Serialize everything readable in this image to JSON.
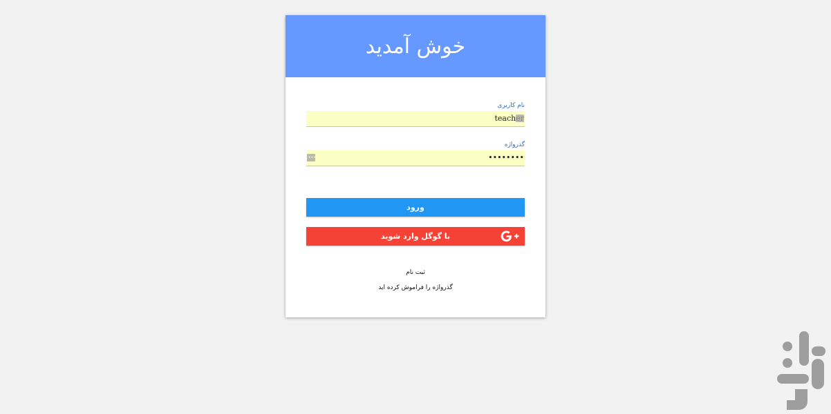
{
  "header": {
    "title": "خوش آمدید"
  },
  "form": {
    "username_label": "نام کاربری",
    "username_value": "teacher",
    "password_label": "گذرواژه",
    "password_value": "teacher1"
  },
  "buttons": {
    "login_label": "ورود",
    "google_label": "با گوگل وارد شوید"
  },
  "links": {
    "register": "ثبت نام",
    "forgot_password": "گذرواژه را فراموش کرده اید"
  },
  "colors": {
    "header": "#6699ff",
    "login_button": "#2196f3",
    "google_button": "#f44336",
    "label": "#2c6db3",
    "autofill_bg": "#fcffc4",
    "brand_logo": "#9e9e9e"
  },
  "icons": {
    "google": "google-plus-icon",
    "autofill_username": "autofill-key-icon",
    "autofill_password": "password-manager-icon",
    "brand": "bazaar-logo-icon"
  }
}
